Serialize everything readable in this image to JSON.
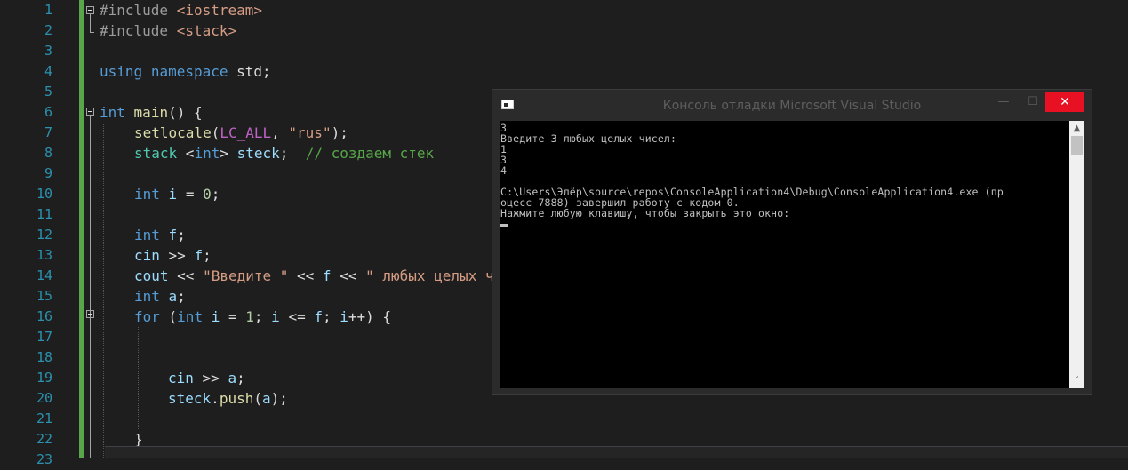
{
  "editor": {
    "line_numbers": [
      "1",
      "2",
      "3",
      "4",
      "5",
      "6",
      "7",
      "8",
      "9",
      "10",
      "11",
      "12",
      "13",
      "14",
      "15",
      "16",
      "17",
      "18",
      "19",
      "20",
      "21",
      "22",
      "23"
    ],
    "code": {
      "l1_a": "#include ",
      "l1_b": "<iostream>",
      "l2_a": "#include ",
      "l2_b": "<stack>",
      "l4_a": "using",
      "l4_b": "namespace",
      "l4_c": "std;",
      "l6_a": "int",
      "l6_b": "main",
      "l6_c": "() {",
      "l7_a": "setlocale",
      "l7_b": "(",
      "l7_c": "LC_ALL",
      "l7_d": ", ",
      "l7_e": "\"rus\"",
      "l7_f": ");",
      "l8_a": "stack",
      "l8_b": " <",
      "l8_c": "int",
      "l8_d": "> ",
      "l8_e": "steck",
      "l8_f": ";  ",
      "l8_g": "// создаем стек",
      "l10_a": "int",
      "l10_b": "i",
      "l10_c": " = ",
      "l10_d": "0",
      "l10_e": ";",
      "l12_a": "int",
      "l12_b": "f",
      "l12_c": ";",
      "l13_a": "cin",
      "l13_b": " >> ",
      "l13_c": "f",
      "l13_d": ";",
      "l14_a": "cout",
      "l14_b": " << ",
      "l14_c": "\"Введите \"",
      "l14_d": " << ",
      "l14_e": "f",
      "l14_f": " << ",
      "l14_g": "\" любых целых ч",
      "l15_a": "int",
      "l15_b": "a",
      "l15_c": ";",
      "l16_a": "for",
      "l16_b": " (",
      "l16_c": "int",
      "l16_d": "i",
      "l16_e": " = ",
      "l16_f": "1",
      "l16_g": "; ",
      "l16_h": "i",
      "l16_i": " <= ",
      "l16_j": "f",
      "l16_k": "; ",
      "l16_l": "i",
      "l16_m": "++) {",
      "l19_a": "cin",
      "l19_b": " >> ",
      "l19_c": "a",
      "l19_d": ";",
      "l20_a": "steck",
      "l20_b": ".",
      "l20_c": "push",
      "l20_d": "(",
      "l20_e": "a",
      "l20_f": ");",
      "l22_a": "}"
    }
  },
  "console": {
    "title": "Консоль отладки Microsoft Visual Studio",
    "min_glyph": "—",
    "max_glyph": "☐",
    "close_glyph": "✕",
    "scroll_up_glyph": "▲",
    "scroll_down_glyph": "˅",
    "lines": [
      "3",
      "Введите 3 любых целых чисел:",
      "1",
      "3",
      "4",
      "",
      "C:\\Users\\Элёр\\source\\repos\\ConsoleApplication4\\Debug\\ConsoleApplication4.exe (пр",
      "оцесс 7888) завершил работу с кодом 0.",
      "Нажмите любую клавишу, чтобы закрыть это окно:"
    ]
  },
  "colors": {
    "editor_bg": "#1e1e1e",
    "line_number": "#2b91af",
    "keyword": "#569cd6",
    "function": "#dcdcaa",
    "type": "#4ec9b0",
    "identifier": "#9cdcfe",
    "string": "#d69d85",
    "comment": "#57a64a",
    "change_bar": "#57a64a",
    "close_button": "#e81123",
    "terminal_bg": "#000000",
    "terminal_text": "#c0c0c0"
  }
}
